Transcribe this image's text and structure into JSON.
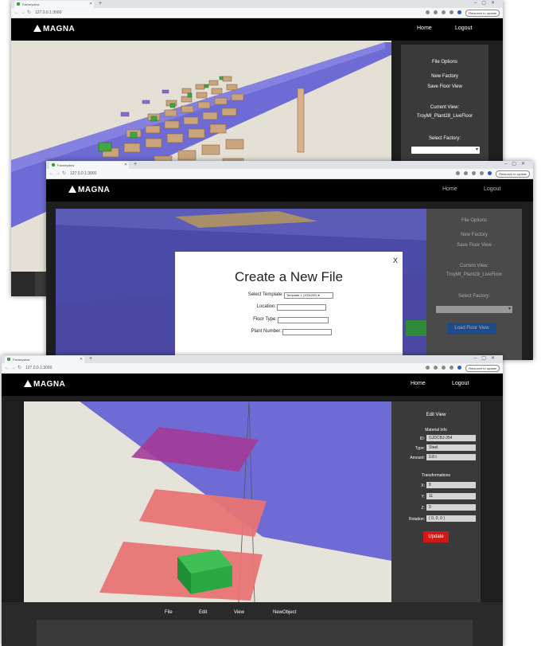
{
  "browser": {
    "tab_title": "Factoryview",
    "url": "127.0.0.1:3000",
    "relaunch_label": "Relaunch to update"
  },
  "header": {
    "logo": "MAGNA",
    "home": "Home",
    "logout": "Logout"
  },
  "sidebar": {
    "file_options": "File Options",
    "new_factory": "New Factory",
    "save_floor_view": "Save Floor View",
    "current_view_label": "Current View:",
    "current_view_value": "TroyMI_Plant28_LiveFloor",
    "select_factory": "Select Factory:",
    "load_floor_view": "Load Floor View"
  },
  "modal": {
    "title": "Create a New File",
    "select_template_label": "Select Template:",
    "template_value": "Template 1 (100x200) ▾",
    "location_label": "Location:",
    "floor_type_label": "Floor Type:",
    "plant_number_label": "Plant Number:",
    "close": "X"
  },
  "edit_view": {
    "title": "Edit View",
    "material_info": "Material Info",
    "id_label": "ID:",
    "id_value": "GJDCBJ-354",
    "type_label": "Type:",
    "type_value": "Steel",
    "amount_label": "Amount:",
    "amount_value": "0.8 t",
    "transformations": "Transformations",
    "x_label": "X:",
    "x_value": "8",
    "y_label": "Y:",
    "y_value": "11",
    "z_label": "Z:",
    "z_value": "0",
    "rotation_label": "Rotation:",
    "rotation_value": "( 0, 0, 0 )",
    "update": "Update"
  },
  "bottom_menu": {
    "file": "File",
    "edit": "Edit",
    "view": "View",
    "new_object": "NewObject"
  },
  "icons": [
    "back-arrow-icon",
    "forward-arrow-icon",
    "reload-icon",
    "info-icon",
    "share-icon",
    "star-icon",
    "extension-icon",
    "profile-icon",
    "close-icon"
  ],
  "colors": {
    "header_bg": "#000000",
    "sidebar_bg": "#3a3a3a",
    "wall_blue": "#6f6bd4",
    "floor": "#e2dfd7",
    "update_red": "#d11818",
    "button_blue": "#2a63b8"
  }
}
